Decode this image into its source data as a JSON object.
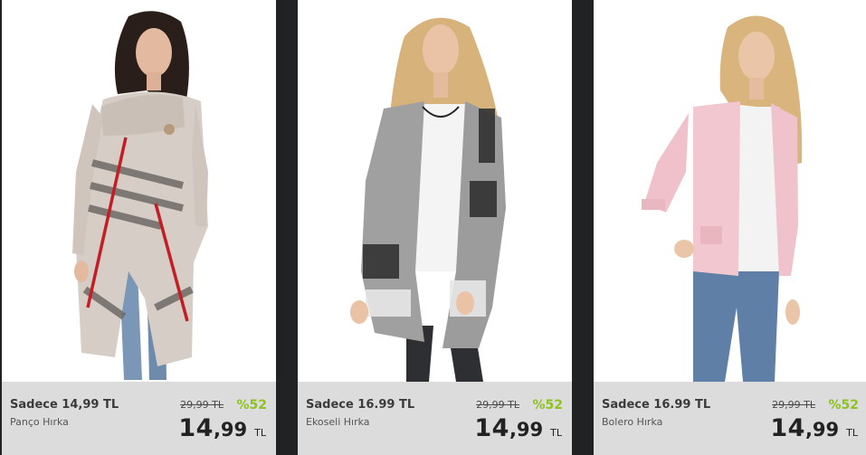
{
  "products": [
    {
      "promo": "Sadece 14,99 TL",
      "name": "Panço Hırka",
      "old_price": "29,99 TL",
      "discount": "%52",
      "price_int": "14",
      "price_dec": ",99",
      "currency": "TL",
      "image_desc": "model-in-beige-plaid-poncho-cardigan"
    },
    {
      "promo": "Sadece 16.99 TL",
      "name": "Ekoseli Hırka",
      "old_price": "29,99 TL",
      "discount": "%52",
      "price_int": "14",
      "price_dec": ",99",
      "currency": "TL",
      "image_desc": "model-in-grey-checked-cardigan"
    },
    {
      "promo": "Sadece 16.99 TL",
      "name": "Bolero Hırka",
      "old_price": "29,99 TL",
      "discount": "%52",
      "price_int": "14",
      "price_dec": ",99",
      "currency": "TL",
      "image_desc": "model-in-pink-bolero-cardigan"
    }
  ],
  "colors": {
    "background": "#202224",
    "price_bar": "#dcdcdc",
    "discount": "#8dc21f"
  }
}
